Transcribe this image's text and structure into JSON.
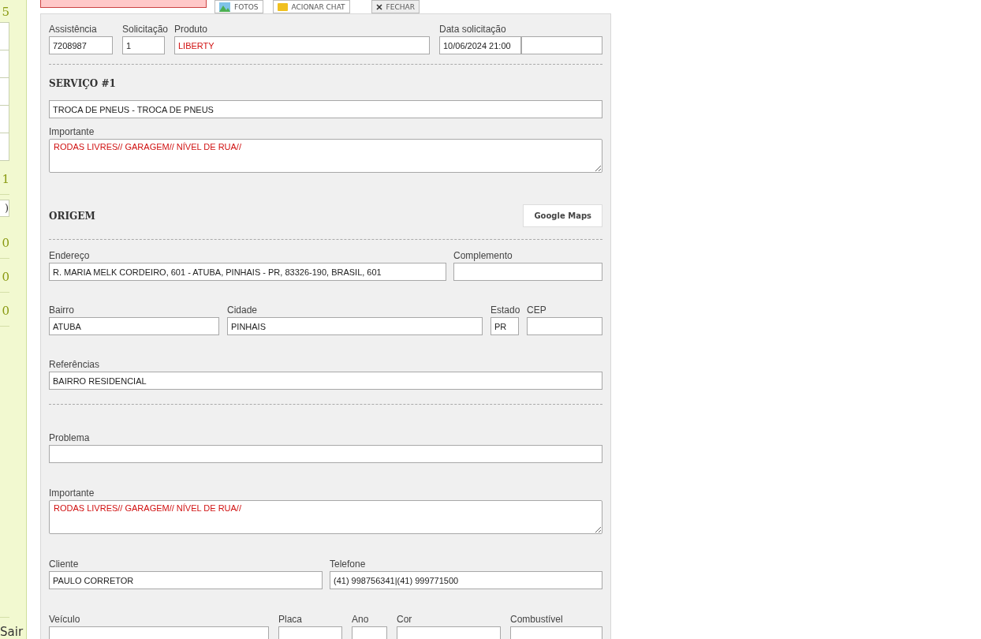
{
  "sidebar": {
    "items": [
      {
        "kind": "number",
        "text": "5"
      },
      {
        "kind": "field"
      },
      {
        "kind": "field"
      },
      {
        "kind": "field"
      },
      {
        "kind": "field"
      },
      {
        "kind": "field"
      },
      {
        "kind": "number",
        "text": "1"
      },
      {
        "kind": "field",
        "value": ")"
      },
      {
        "kind": "number",
        "text": "0"
      },
      {
        "kind": "number",
        "text": "0"
      },
      {
        "kind": "number",
        "text": "0"
      }
    ],
    "exit_link": "Sair"
  },
  "toolbar": {
    "buttons": [
      {
        "kind": "photos",
        "label": "FOTOS"
      },
      {
        "kind": "chat",
        "label": "ACIONAR CHAT"
      },
      {
        "kind": "close",
        "label": "FECHAR"
      }
    ]
  },
  "form": {
    "rows": [
      {
        "kind": "fields",
        "fields": [
          {
            "kind": "input",
            "label": "Assistência",
            "value": "7208987",
            "emphasis": false
          },
          {
            "kind": "input",
            "label": "Solicitação",
            "value": "1",
            "emphasis": false
          },
          {
            "kind": "input",
            "label": "Produto",
            "value": "LIBERTY",
            "emphasis": true
          },
          {
            "kind": "input",
            "label": "Data solicitação",
            "value": "10/06/2024 21:00",
            "emphasis": false
          },
          {
            "kind": "input"
          }
        ]
      },
      {
        "kind": "divider"
      },
      {
        "kind": "heading",
        "title": "SERVIÇO #1"
      },
      {
        "kind": "fields",
        "fields": [
          {
            "kind": "input",
            "value": "TROCA DE PNEUS - TROCA DE PNEUS",
            "emphasis": false
          }
        ]
      },
      {
        "kind": "fields",
        "fields": [
          {
            "kind": "textarea",
            "label": "Importante",
            "value": "RODAS LIVRES// GARAGEM// NÍVEL DE RUA//",
            "emphasis": true
          }
        ]
      },
      {
        "kind": "heading",
        "title": "ORIGEM",
        "button": "Google Maps"
      },
      {
        "kind": "divider"
      },
      {
        "kind": "fields",
        "fields": [
          {
            "kind": "input",
            "label": "Endereço",
            "value": "R. MARIA MELK CORDEIRO, 601 - ATUBA, PINHAIS - PR, 83326-190, BRASIL, 601",
            "emphasis": false
          },
          {
            "kind": "input",
            "label": "Complemento"
          }
        ]
      },
      {
        "kind": "fields",
        "fields": [
          {
            "kind": "input",
            "label": "Bairro",
            "value": "ATUBA",
            "emphasis": false
          },
          {
            "kind": "input",
            "label": "Cidade",
            "value": "PINHAIS",
            "emphasis": false
          },
          {
            "kind": "input",
            "label": "Estado",
            "value": "PR",
            "emphasis": false
          },
          {
            "kind": "input",
            "label": "CEP"
          }
        ]
      },
      {
        "kind": "fields",
        "fields": [
          {
            "kind": "input",
            "label": "Referências",
            "value": "BAIRRO RESIDENCIAL",
            "emphasis": false
          }
        ]
      },
      {
        "kind": "divider"
      },
      {
        "kind": "fields",
        "fields": [
          {
            "kind": "input",
            "label": "Problema"
          }
        ]
      },
      {
        "kind": "fields",
        "fields": [
          {
            "kind": "textarea",
            "label": "Importante",
            "value": "RODAS LIVRES// GARAGEM// NÍVEL DE RUA//",
            "emphasis": true
          }
        ]
      },
      {
        "kind": "fields",
        "fields": [
          {
            "kind": "input",
            "label": "Cliente",
            "value": "PAULO CORRETOR",
            "emphasis": false
          },
          {
            "kind": "input",
            "label": "Telefone",
            "value": "(41) 998756341|(41) 999771500",
            "emphasis": false
          }
        ]
      },
      {
        "kind": "fields",
        "fields": [
          {
            "kind": "input",
            "label": "Veículo"
          },
          {
            "kind": "input",
            "label": "Placa"
          },
          {
            "kind": "input",
            "label": "Ano"
          },
          {
            "kind": "input",
            "label": "Cor"
          },
          {
            "kind": "input",
            "label": "Combustível"
          }
        ]
      }
    ]
  }
}
